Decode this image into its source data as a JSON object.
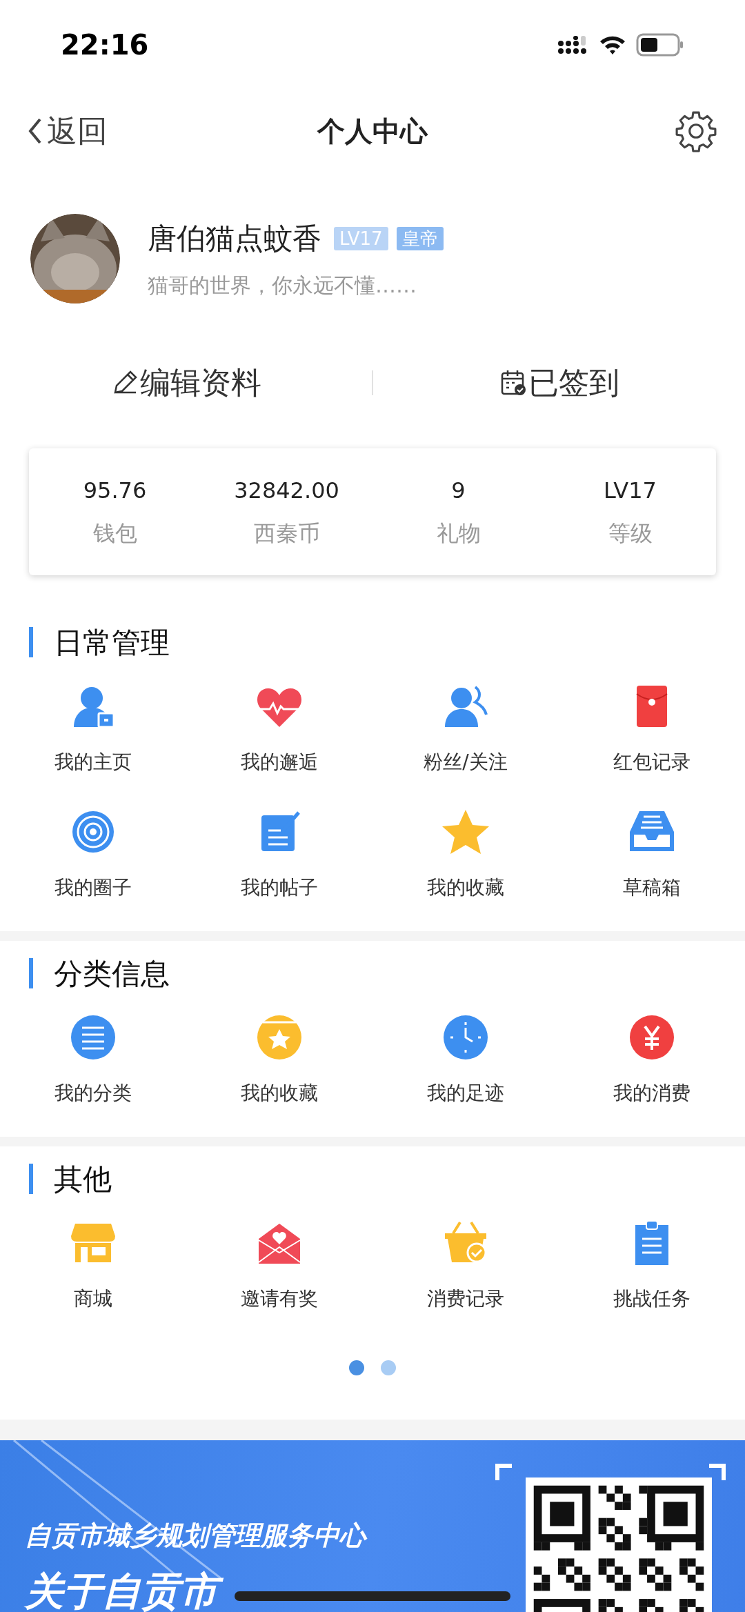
{
  "status_bar": {
    "time": "22:16"
  },
  "nav": {
    "back_label": "返回",
    "title": "个人中心"
  },
  "profile": {
    "name": "唐伯猫点蚊香",
    "badges": [
      {
        "label": "LV17",
        "color": "#b9d4f6"
      },
      {
        "label": "皇帝",
        "color": "#8cbaf2"
      }
    ],
    "signature": "猫哥的世界，你永远不懂……"
  },
  "actions": [
    {
      "kind": "edit",
      "label": "编辑资料"
    },
    {
      "kind": "checkin",
      "label": "已签到"
    }
  ],
  "stats": [
    {
      "value": "95.76",
      "label": "钱包"
    },
    {
      "value": "32842.00",
      "label": "西秦币"
    },
    {
      "value": "9",
      "label": "礼物"
    },
    {
      "value": "LV17",
      "label": "等级"
    }
  ],
  "sections": [
    {
      "title": "日常管理",
      "items": [
        {
          "kind": "home",
          "label": "我的主页"
        },
        {
          "kind": "heartbeat",
          "label": "我的邂逅"
        },
        {
          "kind": "fans",
          "label": "粉丝/关注"
        },
        {
          "kind": "redpacket",
          "label": "红包记录"
        },
        {
          "kind": "circle",
          "label": "我的圈子"
        },
        {
          "kind": "post",
          "label": "我的帖子"
        },
        {
          "kind": "star",
          "label": "我的收藏"
        },
        {
          "kind": "drafts",
          "label": "草稿箱"
        }
      ]
    },
    {
      "title": "分类信息",
      "items": [
        {
          "kind": "category",
          "label": "我的分类"
        },
        {
          "kind": "favorite",
          "label": "我的收藏"
        },
        {
          "kind": "clock",
          "label": "我的足迹"
        },
        {
          "kind": "yen",
          "label": "我的消费"
        }
      ]
    },
    {
      "title": "其他",
      "items": [
        {
          "kind": "shop",
          "label": "商城"
        },
        {
          "kind": "invite",
          "label": "邀请有奖"
        },
        {
          "kind": "basket",
          "label": "消费记录"
        },
        {
          "kind": "task",
          "label": "挑战任务"
        }
      ],
      "pager": [
        {
          "selected": true
        },
        {
          "selected": false
        }
      ]
    }
  ],
  "banner": {
    "subtitle": "自贡市城乡规划管理服务中心",
    "title": "关于自贡市"
  }
}
